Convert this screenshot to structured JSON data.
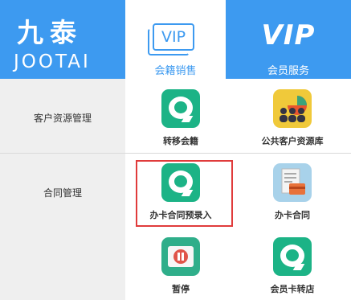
{
  "header": {
    "logo_cn": "九泰",
    "logo_en": "JOOTAI",
    "tabs": [
      {
        "icon_text": "VIP",
        "label": "会籍销售",
        "active": true
      },
      {
        "icon_text": "VIP",
        "label": "会员服务",
        "active": false
      }
    ]
  },
  "sidebar": {
    "items": [
      {
        "label": "客户资源管理"
      },
      {
        "label": "合同管理"
      }
    ]
  },
  "tiles": [
    {
      "label": "转移会籍",
      "icon": "chat-bubble-icon"
    },
    {
      "label": "公共客户资源库",
      "icon": "people-chart-icon"
    },
    {
      "label": "办卡合同预录入",
      "icon": "chat-bubble-icon",
      "highlighted": true
    },
    {
      "label": "办卡合同",
      "icon": "document-card-icon"
    },
    {
      "label": "暂停",
      "icon": "pause-card-icon"
    },
    {
      "label": "会员卡转店",
      "icon": "chat-bubble-icon"
    }
  ],
  "colors": {
    "brand_blue": "#3d9af0",
    "tile_green": "#1cb386",
    "highlight_red": "#e03b3b"
  }
}
